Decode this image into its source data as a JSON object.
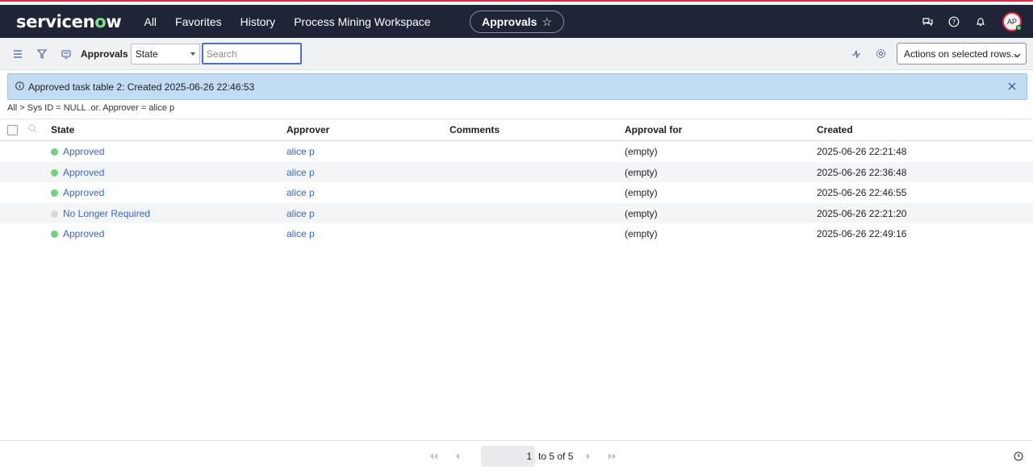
{
  "brand": {
    "name_prefix": "servicen",
    "name_o": "o",
    "name_suffix": "w"
  },
  "nav": {
    "items": [
      "All",
      "Favorites",
      "History",
      "Process Mining Workspace"
    ]
  },
  "context_pill": {
    "label": "Approvals"
  },
  "user": {
    "initials": "AP"
  },
  "toolbar": {
    "title": "Approvals",
    "field_select": "State",
    "search_placeholder": "Search",
    "actions_label": "Actions on selected rows..."
  },
  "info_message": "Approved task table 2: Created 2025-06-26 22:46:53",
  "breadcrumb": "All > Sys ID = NULL .or. Approver = alice p",
  "columns": [
    "State",
    "Approver",
    "Comments",
    "Approval for",
    "Created"
  ],
  "rows": [
    {
      "state": "Approved",
      "state_color": "#6ed47a",
      "approver": "alice p",
      "comments": "",
      "approval_for": "(empty)",
      "created": "2025-06-26 22:21:48"
    },
    {
      "state": "Approved",
      "state_color": "#6ed47a",
      "approver": "alice p",
      "comments": "",
      "approval_for": "(empty)",
      "created": "2025-06-26 22:36:48"
    },
    {
      "state": "Approved",
      "state_color": "#6ed47a",
      "approver": "alice p",
      "comments": "",
      "approval_for": "(empty)",
      "created": "2025-06-26 22:46:55"
    },
    {
      "state": "No Longer Required",
      "state_color": "#d6d8db",
      "approver": "alice p",
      "comments": "",
      "approval_for": "(empty)",
      "created": "2025-06-26 22:21:20"
    },
    {
      "state": "Approved",
      "state_color": "#6ed47a",
      "approver": "alice p",
      "comments": "",
      "approval_for": "(empty)",
      "created": "2025-06-26 22:49:16"
    }
  ],
  "pager": {
    "current": "1",
    "range_text": "to 5 of 5"
  },
  "colors": {
    "header_bg": "#1f2436",
    "accent_red": "#e5253b",
    "link": "#3a66c9",
    "info_bg": "#c2dcf3"
  }
}
